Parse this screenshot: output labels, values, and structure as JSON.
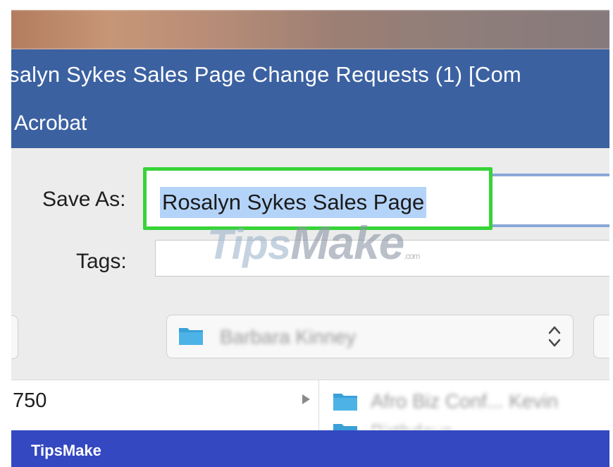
{
  "window": {
    "title": "salyn Sykes Sales Page Change Requests (1) [Com",
    "app_name": "Acrobat"
  },
  "save_dialog": {
    "save_as_label": "Save As:",
    "save_as_value": "Rosalyn Sykes Sales Page",
    "tags_label": "Tags:",
    "tags_value": "",
    "location": "Barbara Kinney"
  },
  "file_browser": {
    "left_column_item": "750",
    "right_column_items": [
      "Afro Biz Conf... Kevin",
      "Birthdays"
    ]
  },
  "watermark": {
    "text_part1": "Tips",
    "text_part2": "Make",
    "suffix": ".com"
  },
  "footer": {
    "brand": "TipsMake"
  },
  "colors": {
    "titlebar": "#3b61a1",
    "highlight_border": "#37d337",
    "selection": "#b4d3f8",
    "footer": "#3448c2",
    "folder": "#3aa0d8"
  },
  "icons": [
    "folder-icon",
    "up-down-chevron-icon",
    "disclosure-arrow-icon"
  ]
}
